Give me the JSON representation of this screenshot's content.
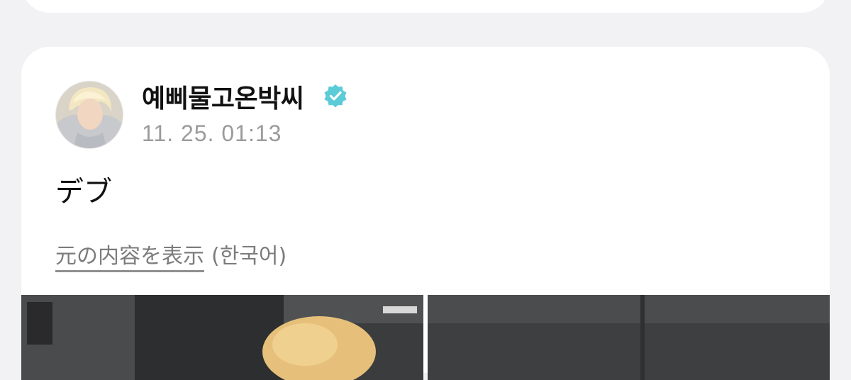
{
  "post": {
    "author_name": "예삐물고온박씨",
    "verified": true,
    "timestamp": "11. 25. 01:13",
    "text": "デブ",
    "show_original_label": "元の内容を表示",
    "original_language": "(한국어)"
  },
  "colors": {
    "background": "#f2f2f4",
    "card": "#ffffff",
    "verified_badge": "#5ccbd8",
    "timestamp": "#9b9b9b",
    "link": "#7c7c7c"
  },
  "icons": {
    "verified": "verified-badge-icon",
    "avatar": "profile-avatar"
  }
}
